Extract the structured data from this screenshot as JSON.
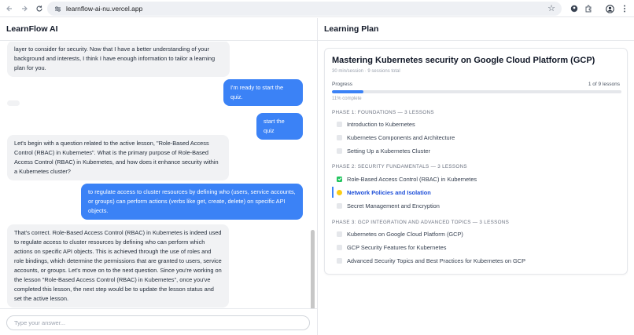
{
  "browser": {
    "url": "learnflow-ai-nu.vercel.app"
  },
  "app": {
    "left_title": "LearnFlow AI",
    "right_title": "Learning Plan"
  },
  "chat": {
    "messages": [
      {
        "role": "assistant",
        "text": "layer to consider for security. Now that I have a better understanding of your background and interests, I think I have enough information to tailor a learning plan for you."
      },
      {
        "role": "user",
        "text": "I'm ready to start the quiz."
      },
      {
        "role": "assistant",
        "text": ""
      },
      {
        "role": "user",
        "text": "start the quiz"
      },
      {
        "role": "assistant",
        "text": "Let's begin with a question related to the active lesson, \"Role-Based Access Control (RBAC) in Kubernetes\". What is the primary purpose of Role-Based Access Control (RBAC) in Kubernetes, and how does it enhance security within a Kubernetes cluster?"
      },
      {
        "role": "user",
        "text": "to regulate access to cluster resources by defining who (users, service accounts, or groups) can perform actions (verbs like get, create, delete) on specific API objects."
      },
      {
        "role": "assistant",
        "text": "That's correct. Role-Based Access Control (RBAC) in Kubernetes is indeed used to regulate access to cluster resources by defining who can perform which actions on specific API objects. This is achieved through the use of roles and role bindings, which determine the permissions that are granted to users, service accounts, or groups. Let's move on to the next question. Since you're working on the lesson \"Role-Based Access Control (RBAC) in Kubernetes\", once you've completed this lesson, the next step would be to update the lesson status and set the active lesson."
      }
    ],
    "input_placeholder": "Type your answer..."
  },
  "plan": {
    "title": "Mastering Kubernetes security on Google Cloud Platform (GCP)",
    "meta": "30 min/session · 9 sessions total",
    "progress_label": "Progress",
    "progress_count": "1 of 9 lessons",
    "progress_fraction": 0.11,
    "progress_sub": "11% complete",
    "accent": "#3b82f6",
    "phases": [
      {
        "title": "PHASE 1: FOUNDATIONS — 3 LESSONS",
        "lessons": [
          {
            "label": "Introduction to Kubernetes",
            "status": "todo"
          },
          {
            "label": "Kubernetes Components and Architecture",
            "status": "todo"
          },
          {
            "label": "Setting Up a Kubernetes Cluster",
            "status": "todo"
          }
        ]
      },
      {
        "title": "PHASE 2: SECURITY FUNDAMENTALS — 3 LESSONS",
        "lessons": [
          {
            "label": "Role-Based Access Control (RBAC) in Kubernetes",
            "status": "done"
          },
          {
            "label": "Network Policies and Isolation",
            "status": "active"
          },
          {
            "label": "Secret Management and Encryption",
            "status": "todo"
          }
        ]
      },
      {
        "title": "PHASE 3: GCP INTEGRATION AND ADVANCED TOPICS — 3 LESSONS",
        "lessons": [
          {
            "label": "Kubernetes on Google Cloud Platform (GCP)",
            "status": "todo"
          },
          {
            "label": "GCP Security Features for Kubernetes",
            "status": "todo"
          },
          {
            "label": "Advanced Security Topics and Best Practices for Kubernetes on GCP",
            "status": "todo"
          }
        ]
      }
    ]
  }
}
